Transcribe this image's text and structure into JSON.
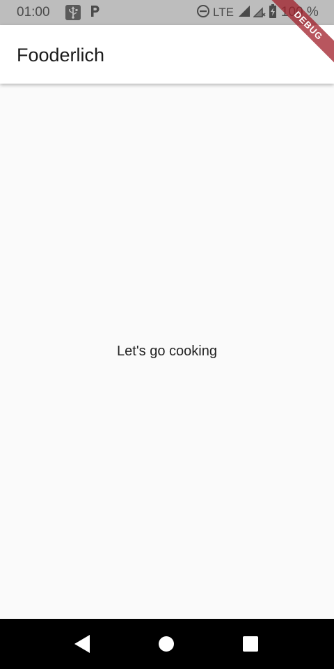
{
  "status_bar": {
    "time": "01:00",
    "network": "LTE",
    "battery": "100 %"
  },
  "debug_banner": {
    "label": "DEBUG"
  },
  "app_bar": {
    "title": "Fooderlich"
  },
  "body": {
    "message": "Let's go cooking"
  },
  "icons": {
    "usb": "usb-icon",
    "parking": "parking-icon",
    "do_not_disturb": "do-not-disturb-icon",
    "signal": "signal-icon",
    "signal_no_data": "signal-no-data-icon",
    "battery": "battery-charging-icon",
    "back": "back-icon",
    "home": "home-icon",
    "recents": "recents-icon"
  },
  "colors": {
    "status_bar": "#bdbdbd",
    "app_bar": "#ffffff",
    "background": "#fafafa",
    "nav_bar": "#000000",
    "debug_ribbon": "#a01e28"
  }
}
